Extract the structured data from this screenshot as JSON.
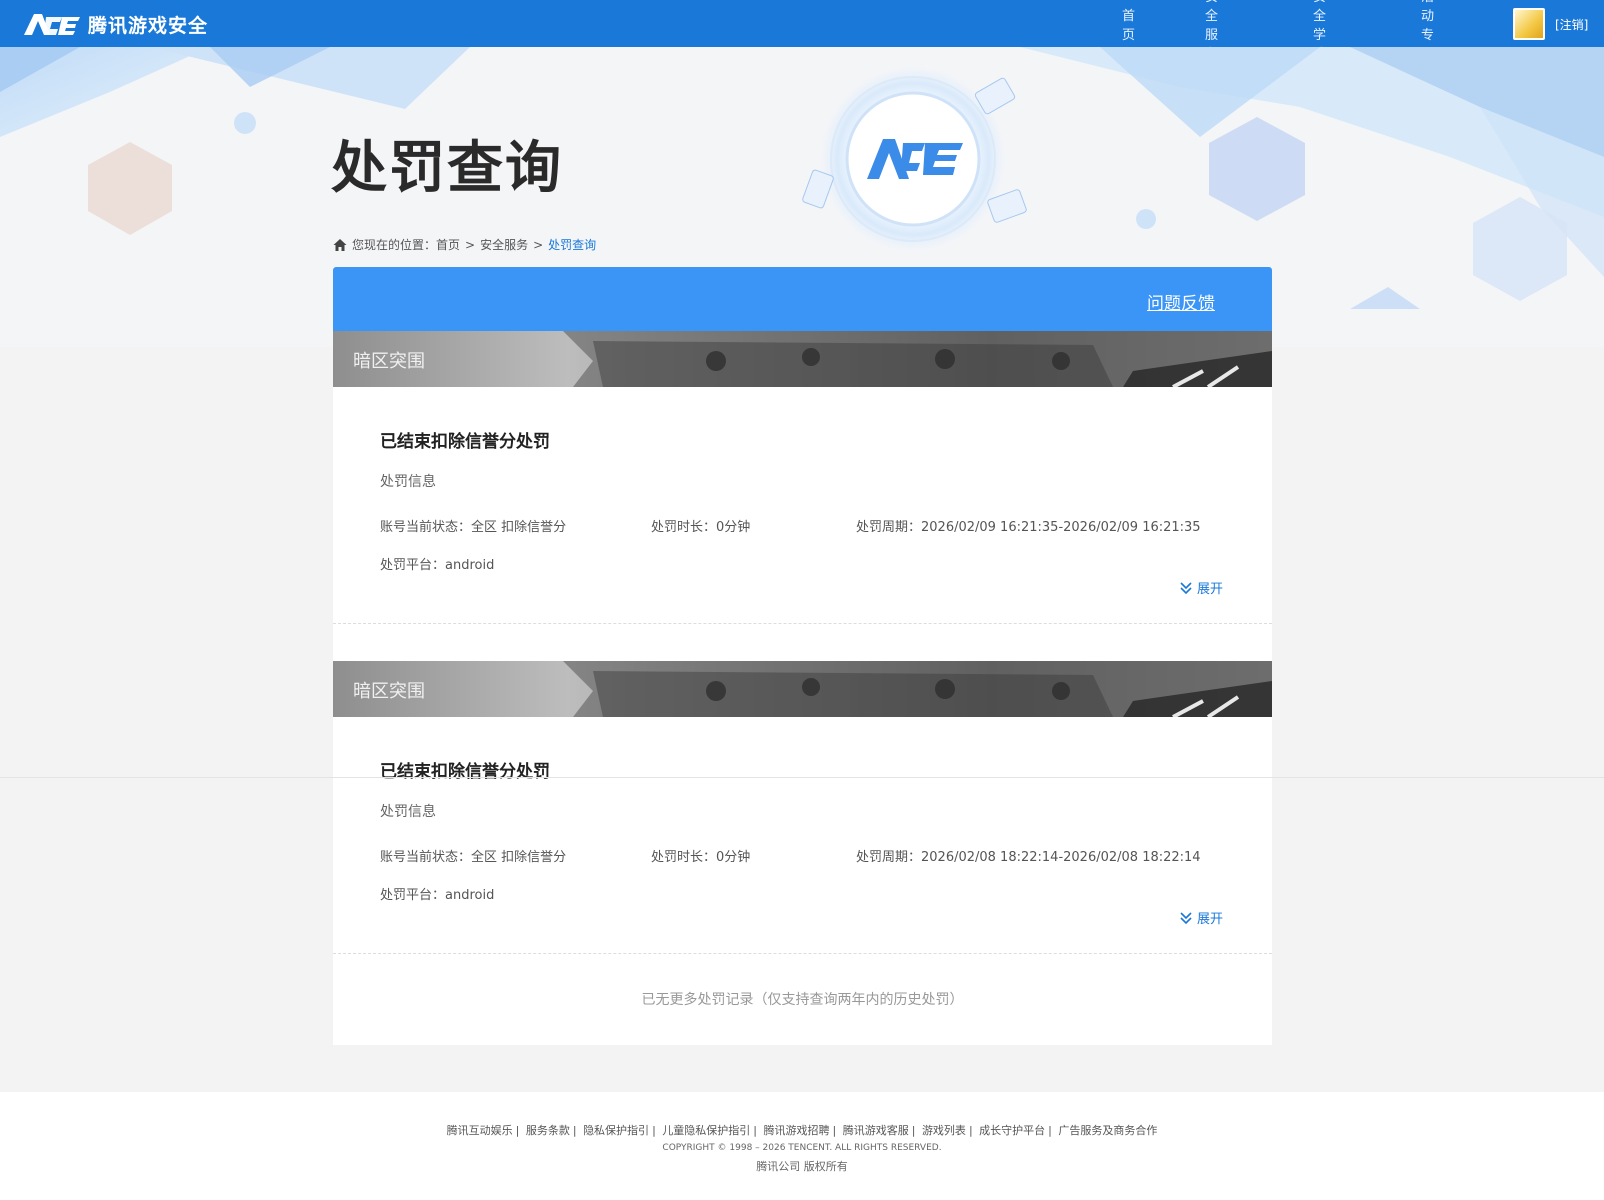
{
  "header": {
    "brand": "腾讯游戏安全",
    "logo_icon": "ace-logo-icon",
    "nav": [
      "首页",
      "安全服务",
      "安全学院",
      "活动专区"
    ],
    "logout": "[注销]"
  },
  "page": {
    "title": "处罚查询",
    "breadcrumb": {
      "prefix": "您现在的位置：",
      "items": [
        "首页",
        "安全服务",
        "处罚查询"
      ],
      "separator": ">"
    }
  },
  "panel": {
    "feedback": "问题反馈",
    "records": [
      {
        "game": "暗区突围",
        "title": "已结束扣除信誉分处罚",
        "section": "处罚信息",
        "status": "账号当前状态：全区 扣除信誉分",
        "duration": "处罚时长：0分钟",
        "period": "处罚周期：2026/02/09 16:21:35-2026/02/09 16:21:35",
        "platform": "处罚平台：android",
        "expand": "展开"
      },
      {
        "game": "暗区突围",
        "title": "已结束扣除信誉分处罚",
        "section": "处罚信息",
        "status": "账号当前状态：全区 扣除信誉分",
        "duration": "处罚时长：0分钟",
        "period": "处罚周期：2026/02/08 18:22:14-2026/02/08 18:22:14",
        "platform": "处罚平台：android",
        "expand": "展开"
      }
    ],
    "no_more": "已无更多处罚记录（仅支持查询两年内的历史处罚）"
  },
  "footer": {
    "links": [
      "腾讯互动娱乐",
      "服务条款",
      "隐私保护指引",
      "儿童隐私保护指引",
      "腾讯游戏招聘",
      "腾讯游戏客服",
      "游戏列表",
      "成长守护平台",
      "广告服务及商务合作"
    ],
    "copyright": "COPYRIGHT © 1998 – 2026 TENCENT. ALL RIGHTS RESERVED.",
    "company": "腾讯公司 版权所有"
  },
  "colors": {
    "header_bg": "#1a78d8",
    "panel_head": "#3b95f7",
    "link": "#1a78d8"
  }
}
